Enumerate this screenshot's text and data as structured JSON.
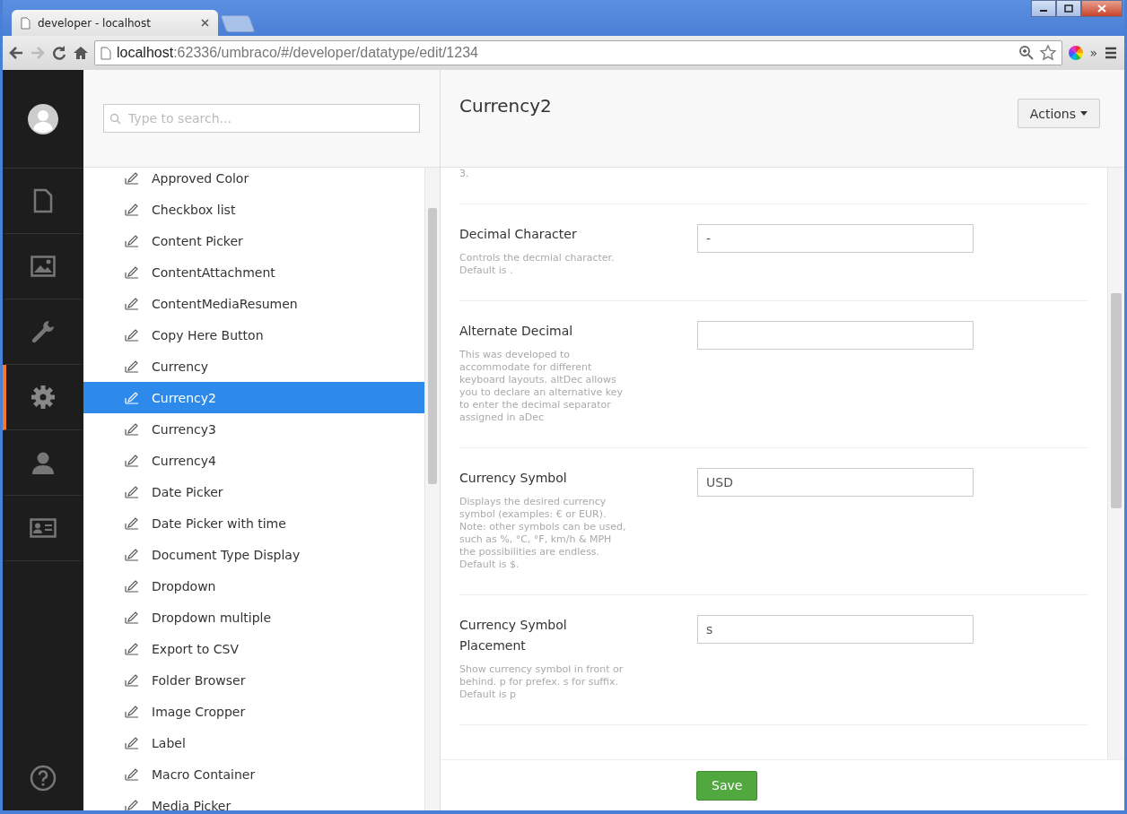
{
  "browser": {
    "tabs": [
      {
        "title": "developer - localhost",
        "selected": true
      }
    ],
    "address": {
      "host": "localhost",
      "path": ":62336/umbraco/#/developer/datatype/edit/1234"
    },
    "overflow": "»"
  },
  "nav": [
    {
      "kind": "content",
      "selected": false
    },
    {
      "kind": "media",
      "selected": false
    },
    {
      "kind": "developer",
      "selected": false
    },
    {
      "kind": "settings",
      "selected": true
    },
    {
      "kind": "users",
      "selected": false
    },
    {
      "kind": "members",
      "selected": false
    }
  ],
  "search": {
    "placeholder": "Type to search..."
  },
  "tree": [
    {
      "label": "Approved Color",
      "selected": false
    },
    {
      "label": "Checkbox list",
      "selected": false
    },
    {
      "label": "Content Picker",
      "selected": false
    },
    {
      "label": "ContentAttachment",
      "selected": false
    },
    {
      "label": "ContentMediaResumen",
      "selected": false
    },
    {
      "label": "Copy Here Button",
      "selected": false
    },
    {
      "label": "Currency",
      "selected": false
    },
    {
      "label": "Currency2",
      "selected": true
    },
    {
      "label": "Currency3",
      "selected": false
    },
    {
      "label": "Currency4",
      "selected": false
    },
    {
      "label": "Date Picker",
      "selected": false
    },
    {
      "label": "Date Picker with time",
      "selected": false
    },
    {
      "label": "Document Type Display",
      "selected": false
    },
    {
      "label": "Dropdown",
      "selected": false
    },
    {
      "label": "Dropdown multiple",
      "selected": false
    },
    {
      "label": "Export to CSV",
      "selected": false
    },
    {
      "label": "Folder Browser",
      "selected": false
    },
    {
      "label": "Image Cropper",
      "selected": false
    },
    {
      "label": "Label",
      "selected": false
    },
    {
      "label": "Macro Container",
      "selected": false
    },
    {
      "label": "Media Picker",
      "selected": false
    }
  ],
  "editor": {
    "title": "Currency2",
    "actions": "Actions",
    "cut_description": "3.",
    "fields": [
      {
        "label": "Decimal Character",
        "description": "Controls the decmial character. Default is .",
        "value": "-"
      },
      {
        "label": "Alternate Decimal",
        "description": "This was developed to accommodate for different keyboard layouts. altDec allows you to declare an alternative key to enter the decimal separator assigned in aDec"
      },
      {
        "label": "Currency Symbol",
        "description": "Displays the desired currency symbol (examples: € or EUR). Note: other symbols can be used, such as %, °C, °F, km/h & MPH the possibilities are endless. Default is $.",
        "value": "USD"
      },
      {
        "label": "Currency Symbol Placement",
        "description": "Show currency symbol in front or behind. p for prefex. s for suffix. Default is p",
        "value": "s"
      }
    ],
    "save": "Save"
  }
}
